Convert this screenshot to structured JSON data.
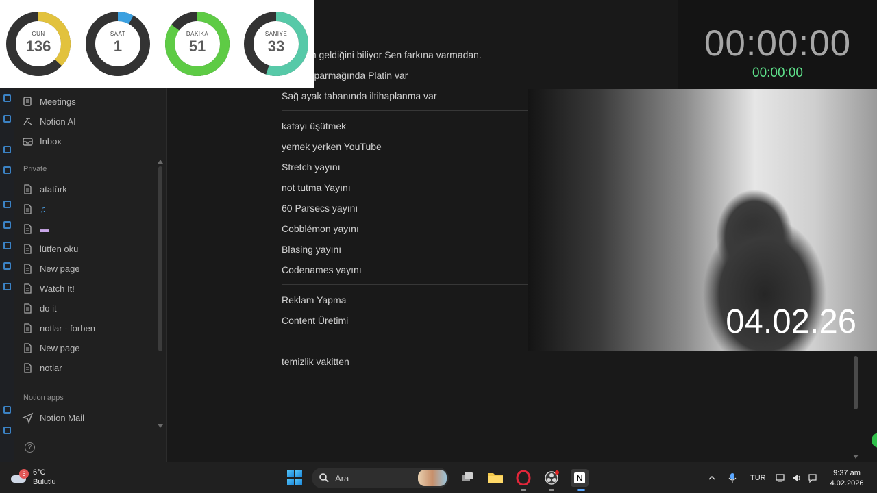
{
  "countdown": {
    "gauges": [
      {
        "label": "GÜN",
        "value": "136",
        "fraction": 0.37,
        "color": "#e2c23d"
      },
      {
        "label": "SAAT",
        "value": "1",
        "fraction": 0.08,
        "color": "#3ba0e0"
      },
      {
        "label": "DAKİKA",
        "value": "51",
        "fraction": 0.85,
        "color": "#5ecb45"
      },
      {
        "label": "SANİYE",
        "value": "33",
        "fraction": 0.55,
        "color": "#57c9a8"
      }
    ]
  },
  "timers": {
    "main": "00:00:00",
    "sub": "00:00:00"
  },
  "webcam": {
    "date": "04.02.26"
  },
  "sidebar": {
    "top_items": [
      {
        "label": "Meetings",
        "icon": "meetings-icon"
      },
      {
        "label": "Notion AI",
        "icon": "notion-ai-icon"
      },
      {
        "label": "Inbox",
        "icon": "inbox-icon"
      }
    ],
    "private_label": "Private",
    "pages": [
      {
        "label": "atatürk"
      },
      {
        "label": "♫"
      },
      {
        "label": "▬"
      },
      {
        "label": "lütfen oku"
      },
      {
        "label": "New page"
      },
      {
        "label": "Watch It!"
      },
      {
        "label": "do it"
      },
      {
        "label": "notlar - forben"
      },
      {
        "label": "New page"
      },
      {
        "label": "notlar"
      }
    ],
    "apps_label": "Notion apps",
    "apps": [
      {
        "label": "Notion Mail",
        "icon": "send-icon"
      }
    ],
    "help": "?"
  },
  "document": {
    "top_lines": [
      "an onun geldiğini biliyor Sen farkına varmadan.",
      "yüssük parmağında Platin var",
      "Sağ ayak tabanında iltihaplanma var"
    ],
    "list_a": [
      "kafayı üşütmek",
      "yemek yerken YouTube",
      "Stretch yayını",
      "not tutma Yayını",
      "60 Parsecs yayını",
      "Cobblémon yayını",
      "Blasing yayını",
      "Codenames yayını"
    ],
    "list_b": [
      "Reklam Yapma",
      "Content Üretimi"
    ],
    "typing_line": "temizlik vakitten"
  },
  "taskbar": {
    "weather_temp": "6°C",
    "weather_desc": "Bulutlu",
    "weather_badge": "6",
    "search_placeholder": "Ara",
    "language": "TUR",
    "time": "9:37 am",
    "date": "4.02.2026"
  }
}
